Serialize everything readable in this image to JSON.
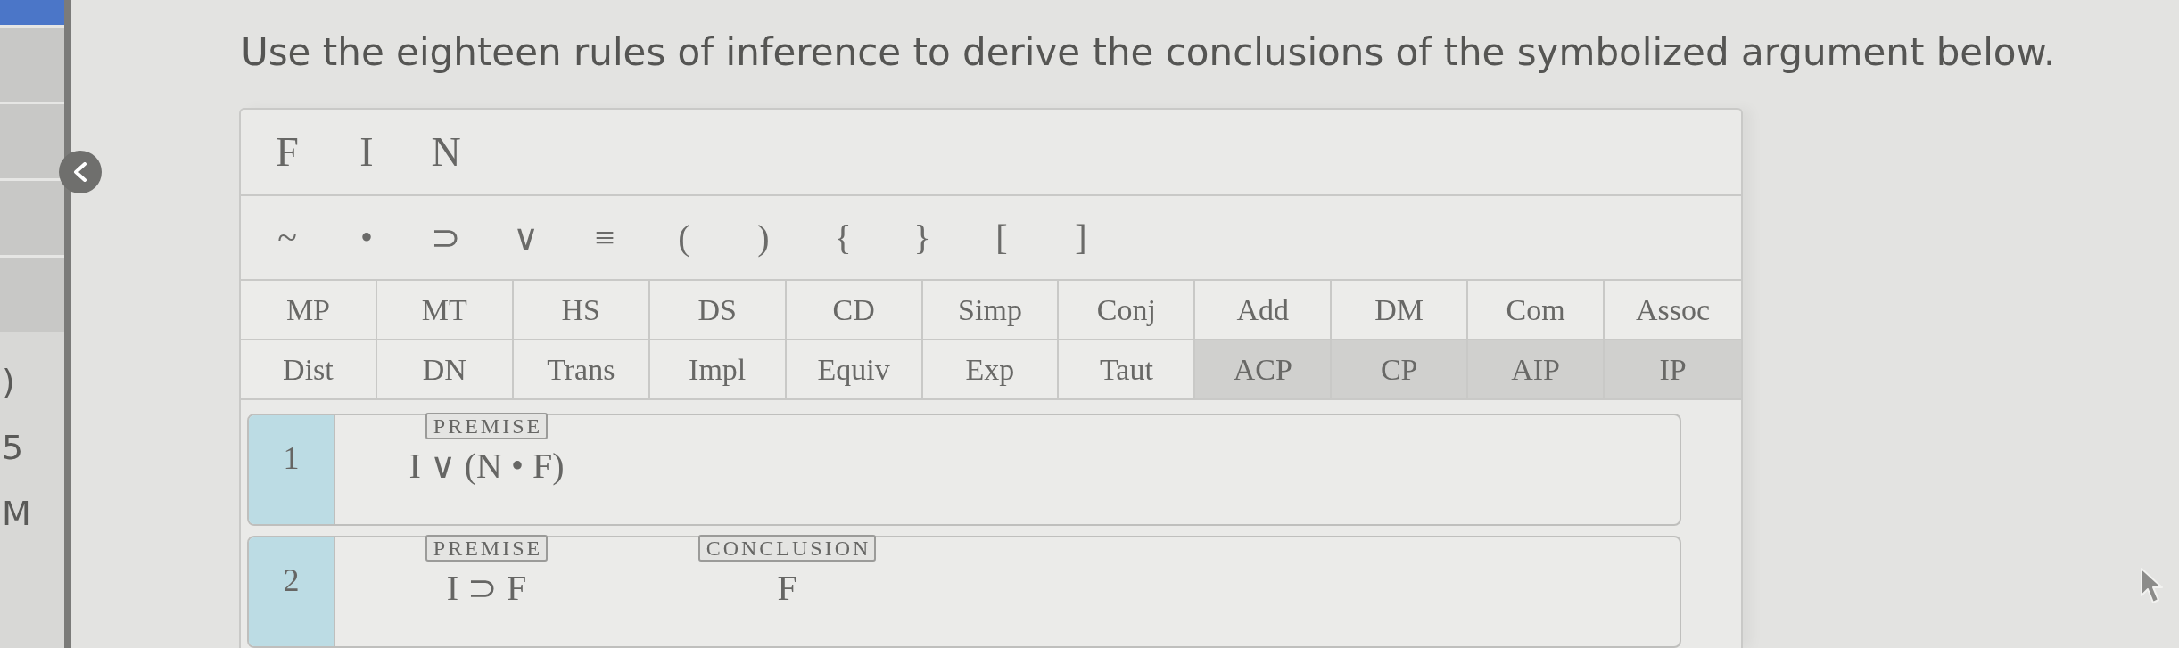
{
  "sidebar": {
    "labels": [
      ")",
      "5",
      "M"
    ]
  },
  "instruction": "Use the eighteen rules of inference to derive the conclusions of the symbolized argument below.",
  "variables": [
    "F",
    "I",
    "N"
  ],
  "operators": [
    "~",
    "•",
    "⊃",
    "∨",
    "≡",
    "(",
    ")",
    "{",
    "}",
    "[",
    "]"
  ],
  "rules": [
    {
      "label": "MP",
      "disabled": false
    },
    {
      "label": "MT",
      "disabled": false
    },
    {
      "label": "HS",
      "disabled": false
    },
    {
      "label": "DS",
      "disabled": false
    },
    {
      "label": "CD",
      "disabled": false
    },
    {
      "label": "Simp",
      "disabled": false
    },
    {
      "label": "Conj",
      "disabled": false
    },
    {
      "label": "Add",
      "disabled": false
    },
    {
      "label": "DM",
      "disabled": false
    },
    {
      "label": "Com",
      "disabled": false
    },
    {
      "label": "Assoc",
      "disabled": false
    },
    {
      "label": "Dist",
      "disabled": false
    },
    {
      "label": "DN",
      "disabled": false
    },
    {
      "label": "Trans",
      "disabled": false
    },
    {
      "label": "Impl",
      "disabled": false
    },
    {
      "label": "Equiv",
      "disabled": false
    },
    {
      "label": "Exp",
      "disabled": false
    },
    {
      "label": "Taut",
      "disabled": false
    },
    {
      "label": "ACP",
      "disabled": true
    },
    {
      "label": "CP",
      "disabled": true
    },
    {
      "label": "AIP",
      "disabled": true
    },
    {
      "label": "IP",
      "disabled": true
    }
  ],
  "proof": {
    "lines": [
      {
        "number": "1",
        "entries": [
          {
            "tag": "PREMISE",
            "formula": "I ∨ (N • F)"
          }
        ]
      },
      {
        "number": "2",
        "entries": [
          {
            "tag": "PREMISE",
            "formula": "I ⊃ F"
          },
          {
            "tag": "CONCLUSION",
            "formula": "F"
          }
        ]
      }
    ]
  }
}
